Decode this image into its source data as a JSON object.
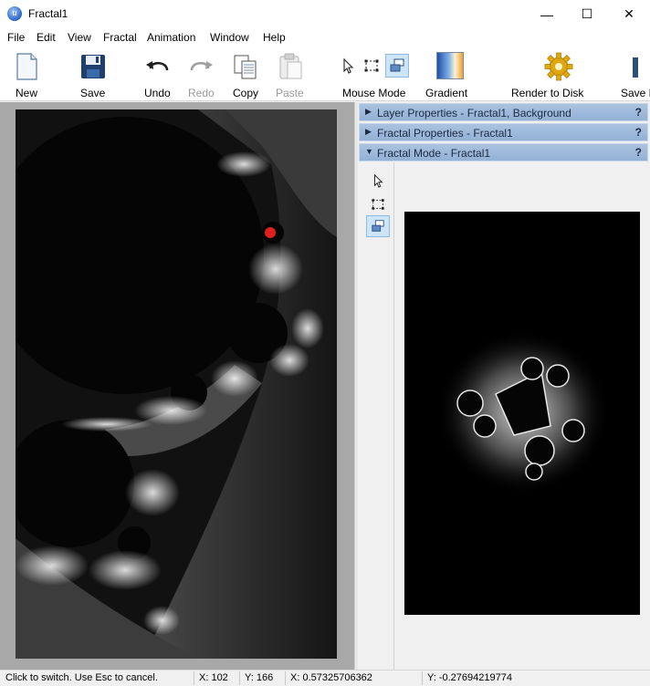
{
  "window": {
    "title": "Fractal1",
    "minimize_glyph": "—",
    "maximize_glyph": "☐",
    "close_glyph": "✕"
  },
  "menu": [
    "File",
    "Edit",
    "View",
    "Fractal",
    "Animation",
    "Window",
    "Help"
  ],
  "toolbar": {
    "new_label": "New",
    "save_label": "Save",
    "undo_label": "Undo",
    "redo_label": "Redo",
    "copy_label": "Copy",
    "paste_label": "Paste",
    "mouse_mode_label": "Mouse Mode",
    "gradient_label": "Gradient",
    "render_label": "Render to Disk",
    "save_partial_label": "Save F",
    "icons": {
      "new": "new-document-icon",
      "save": "floppy-disk-icon",
      "undo": "undo-arrow-icon",
      "redo": "redo-arrow-icon",
      "copy": "copy-icon",
      "paste": "paste-icon",
      "mouse_select": "pointer-icon",
      "mouse_box": "selection-box-icon",
      "mouse_move": "move-view-icon",
      "gradient": "gradient-icon",
      "render": "gear-icon"
    }
  },
  "panels": {
    "layer_properties": "Layer Properties - Fractal1, Background",
    "fractal_properties": "Fractal Properties - Fractal1",
    "fractal_mode": "Fractal Mode - Fractal1",
    "help_glyph": "?"
  },
  "statusbar": {
    "hint": "Click to switch. Use Esc to cancel.",
    "x_pixel": "X: 102",
    "y_pixel": "Y: 166",
    "x_coord": "X: 0.57325706362",
    "y_coord": "Y: -0.27694219774"
  },
  "colors": {
    "panel_header": "#9db9dc",
    "selected_tool": "#cde5f8",
    "marker": "#e02020",
    "canvas_bg": "#a8a8a8"
  }
}
